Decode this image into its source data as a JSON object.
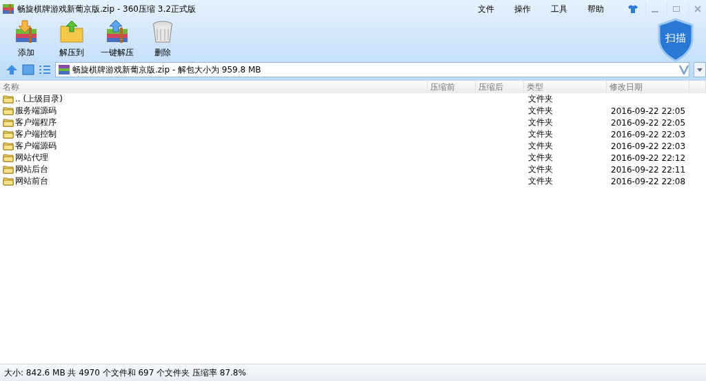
{
  "window": {
    "title": "畅旋棋牌游戏新葡京版.zip - 360压缩 3.2正式版"
  },
  "menu": [
    "文件",
    "操作",
    "工具",
    "帮助"
  ],
  "toolbar": [
    {
      "label": "添加",
      "kind": "add"
    },
    {
      "label": "解压到",
      "kind": "extract"
    },
    {
      "label": "一键解压",
      "kind": "quick"
    },
    {
      "label": "删除",
      "kind": "delete"
    }
  ],
  "scan_button": "扫描",
  "address": {
    "value": "畅旋棋牌游戏新葡京版.zip - 解包大小为 959.8 MB"
  },
  "table": {
    "columns": [
      "名称",
      "压缩前",
      "压缩后",
      "类型",
      "修改日期"
    ],
    "rows": [
      {
        "name": ".. (上级目录)",
        "type": "文件夹",
        "modified": ""
      },
      {
        "name": "服务端源码",
        "type": "文件夹",
        "modified": "2016-09-22 22:05"
      },
      {
        "name": "客户端程序",
        "type": "文件夹",
        "modified": "2016-09-22 22:05"
      },
      {
        "name": "客户端控制",
        "type": "文件夹",
        "modified": "2016-09-22 22:03"
      },
      {
        "name": "客户端源码",
        "type": "文件夹",
        "modified": "2016-09-22 22:03"
      },
      {
        "name": "网站代理",
        "type": "文件夹",
        "modified": "2016-09-22 22:12"
      },
      {
        "name": "网站后台",
        "type": "文件夹",
        "modified": "2016-09-22 22:11"
      },
      {
        "name": "网站前台",
        "type": "文件夹",
        "modified": "2016-09-22 22:08"
      }
    ]
  },
  "status_bar": "大小: 842.6 MB 共 4970 个文件和 697 个文件夹 压缩率 87.8%"
}
